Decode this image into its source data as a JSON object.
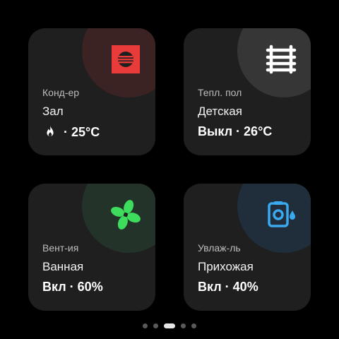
{
  "tiles": [
    {
      "type": "Конд-ер",
      "room": "Зал",
      "status_icon": "flame-icon",
      "value": "25°C",
      "separator": "·",
      "icon": "air-conditioner-icon",
      "accent": "#ea3b3b",
      "blob": "#3a2322"
    },
    {
      "type": "Тепл. пол",
      "room": "Детская",
      "state": "Выкл",
      "value": "26°C",
      "separator": "·",
      "icon": "heated-floor-icon",
      "accent": "#ffffff",
      "blob": "#363636"
    },
    {
      "type": "Вент-ия",
      "room": "Ванная",
      "state": "Вкл",
      "value": "60%",
      "separator": "·",
      "icon": "fan-icon",
      "accent": "#3ddc5c",
      "blob": "#23332a"
    },
    {
      "type": "Увлаж-ль",
      "room": "Прихожая",
      "state": "Вкл",
      "value": "40%",
      "separator": "·",
      "icon": "humidifier-icon",
      "accent": "#3aa9f0",
      "blob": "#1f2e3a"
    }
  ],
  "pager": {
    "count": 5,
    "active_index": 2
  }
}
